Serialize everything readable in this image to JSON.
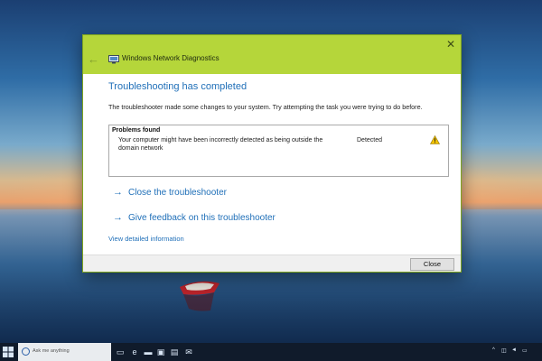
{
  "window": {
    "title": "Windows Network Diagnostics"
  },
  "content": {
    "heading": "Troubleshooting has completed",
    "description": "The troubleshooter made some changes to your system. Try attempting the task you were trying to do before.",
    "problems": {
      "header": "Problems found",
      "items": [
        {
          "text": "Your computer might have been incorrectly detected as being outside the domain network",
          "status": "Detected",
          "icon": "warning-icon"
        }
      ]
    },
    "links": [
      {
        "label": "Close the troubleshooter",
        "icon": "arrow-right-icon"
      },
      {
        "label": "Give feedback on this troubleshooter",
        "icon": "arrow-right-icon"
      }
    ],
    "detail_link": "View detailed information"
  },
  "footer": {
    "close_label": "Close"
  },
  "taskbar": {
    "search_placeholder": "Ask me anything"
  },
  "colors": {
    "titlebar": "#b5d63a",
    "link": "#1f6fb8",
    "taskbar": "#101b2b"
  }
}
